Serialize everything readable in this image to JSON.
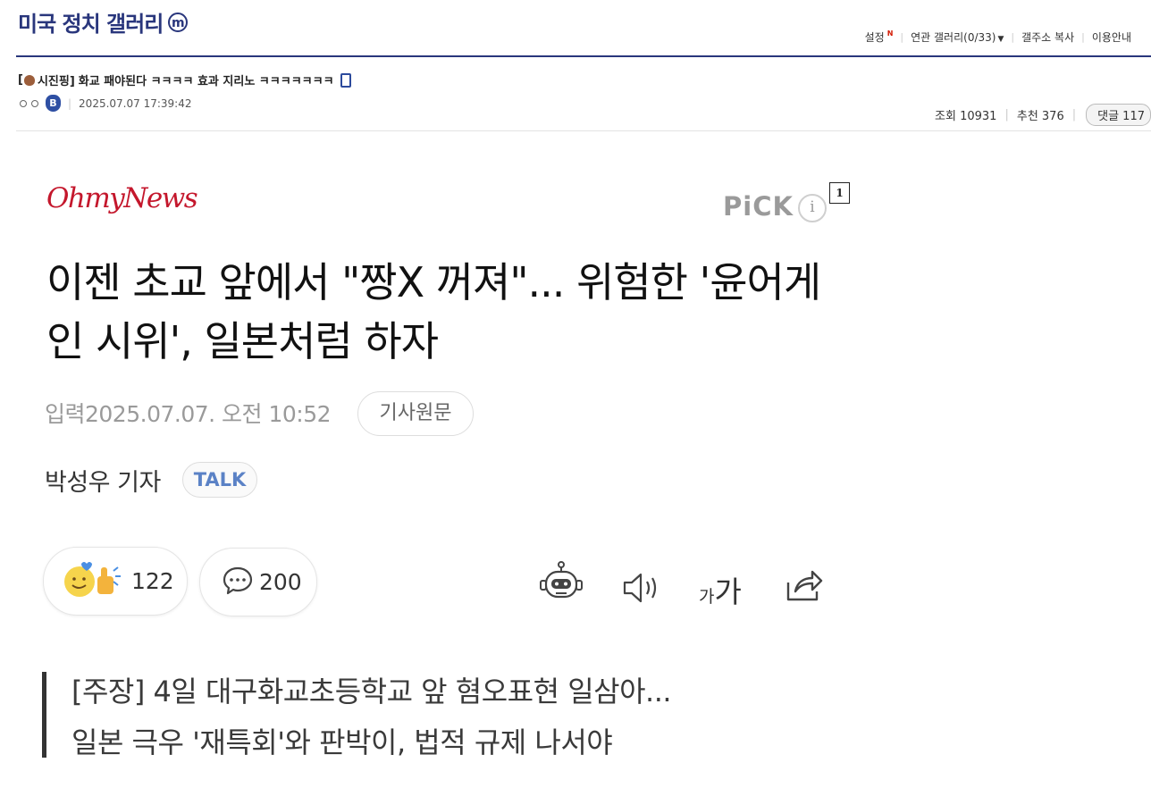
{
  "gallery": {
    "title": "미국 정치 갤러리",
    "badge": "m",
    "nav": {
      "settings": "설정",
      "settings_new": "N",
      "related": "연관 갤러리(0/33)",
      "copy_address": "갤주소 복사",
      "guide": "이용안내"
    }
  },
  "post": {
    "title": "[💩시진핑] 화교 패야된다 ㅋㅋㅋㅋ 효과 지리노 ㅋㅋㅋㅋㅋㅋㅋ",
    "title_prefix": "[",
    "title_tag": "시진핑]",
    "title_text": "화교 패야된다 ㅋㅋㅋㅋ 효과 지리노 ㅋㅋㅋㅋㅋㅋㅋ",
    "author_badge": "B",
    "datetime": "2025.07.07 17:39:42",
    "views_label": "조회 10931",
    "recommend_label": "추천 376",
    "comments_label": "댓글 117"
  },
  "article": {
    "source": "OhmyNews",
    "pick": "PiCK",
    "pick_info": "i",
    "footnote": "1",
    "headline": "이젠 초교 앞에서 \"짱X 꺼져\"... 위험한 '윤어게인 시위', 일본처럼 하자",
    "input_time": "입력2025.07.07. 오전 10:52",
    "original_button": "기사원문",
    "reporter": "박성우 기자",
    "talk_button": "TALK",
    "reaction_count": "122",
    "comment_count": "200",
    "font_tool_small": "가",
    "font_tool_large": "가",
    "summary_line1": "[주장] 4일 대구화교초등학교 앞 혐오표현 일삼아...",
    "summary_line2": "일본 극우 '재특회'와 판박이, 법적 규제 나서야"
  },
  "colors": {
    "gallery_blue": "#29367c",
    "ohmynews_red": "#c4172c",
    "talk_blue": "#5b82c6"
  }
}
